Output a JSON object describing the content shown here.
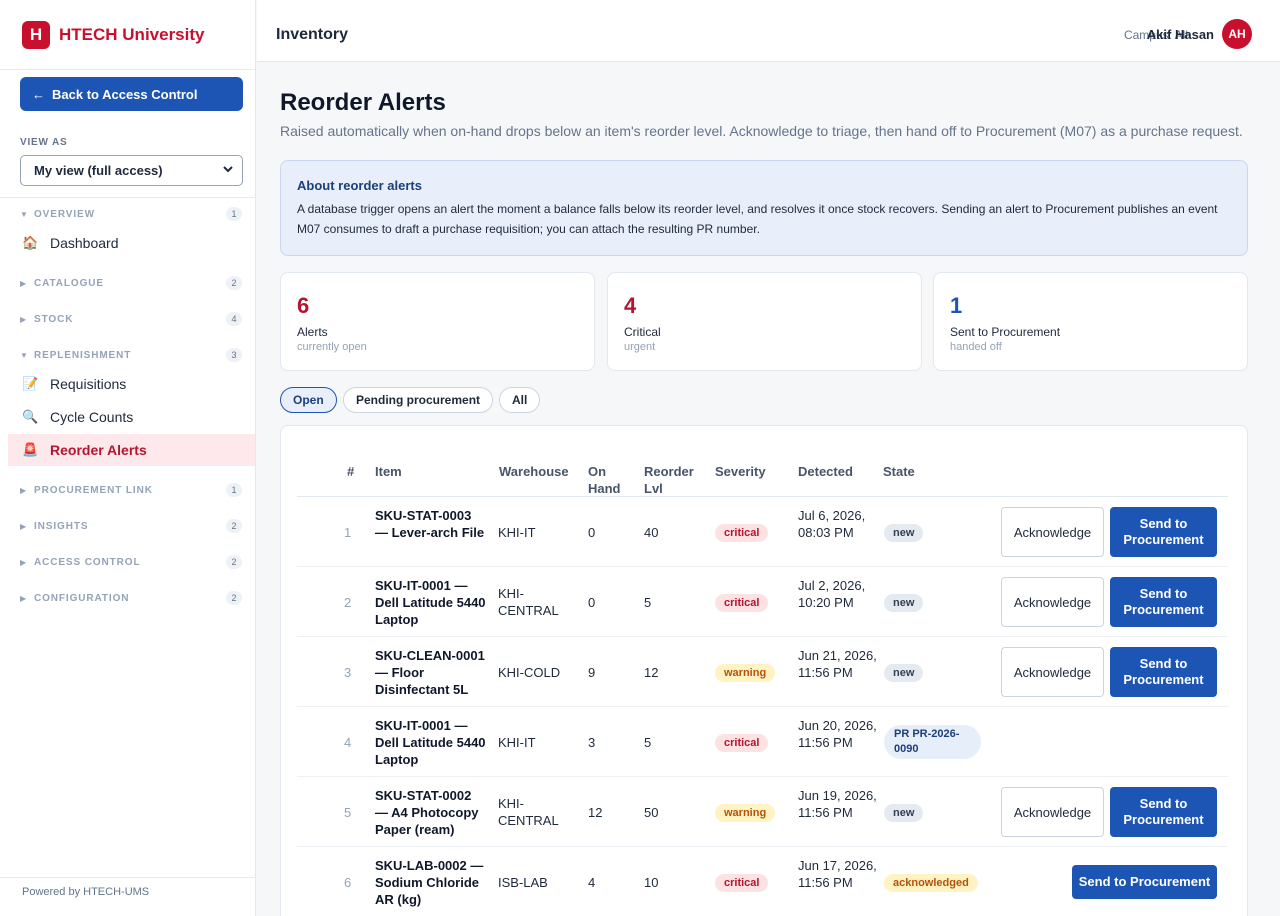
{
  "brand": {
    "logo_letter": "H",
    "name": "HTECH University",
    "color": "#c8102e"
  },
  "sidebar": {
    "back_label": "Back to Access Control",
    "view_as_label": "VIEW AS",
    "view_as_value": "My view (full access)",
    "sections": [
      {
        "title": "OVERVIEW",
        "count": "1",
        "expanded": true,
        "items": [
          {
            "label": "Dashboard",
            "icon": "house-icon"
          }
        ]
      },
      {
        "title": "CATALOGUE",
        "count": "2",
        "expanded": false,
        "items": []
      },
      {
        "title": "STOCK",
        "count": "4",
        "expanded": false,
        "items": []
      },
      {
        "title": "REPLENISHMENT",
        "count": "3",
        "expanded": true,
        "items": [
          {
            "label": "Requisitions",
            "icon": "memo-icon"
          },
          {
            "label": "Cycle Counts",
            "icon": "magnifier-icon"
          },
          {
            "label": "Reorder Alerts",
            "icon": "siren-icon",
            "active": true
          }
        ]
      },
      {
        "title": "PROCUREMENT LINK",
        "count": "1",
        "expanded": false,
        "items": []
      },
      {
        "title": "INSIGHTS",
        "count": "2",
        "expanded": false,
        "items": []
      },
      {
        "title": "ACCESS CONTROL",
        "count": "2",
        "expanded": false,
        "items": []
      },
      {
        "title": "CONFIGURATION",
        "count": "2",
        "expanded": false,
        "items": []
      }
    ],
    "footer": "Powered by HTECH-UMS"
  },
  "topbar": {
    "title": "Inventory",
    "campus": "Campus: All",
    "user_name": "Akif Hasan",
    "avatar_initials": "AH"
  },
  "page": {
    "title": "Reorder Alerts",
    "subtitle": "Raised automatically when on-hand drops below an item's reorder level. Acknowledge to triage, then hand off to Procurement (M07) as a purchase request."
  },
  "info": {
    "title": "About reorder alerts",
    "body": "A database trigger opens an alert the moment a balance falls below its reorder level, and resolves it once stock recovers. Sending an alert to Procurement publishes an event M07 consumes to draft a purchase requisition; you can attach the resulting PR number."
  },
  "stats": [
    {
      "value": "6",
      "label": "Alerts",
      "sub": "currently open",
      "color": "#b4152f"
    },
    {
      "value": "4",
      "label": "Critical",
      "sub": "urgent",
      "color": "#b4152f"
    },
    {
      "value": "1",
      "label": "Sent to Procurement",
      "sub": "handed off",
      "color": "#1d55b4"
    }
  ],
  "filters": [
    {
      "label": "Open",
      "active": true
    },
    {
      "label": "Pending procurement",
      "active": false
    },
    {
      "label": "All",
      "active": false
    }
  ],
  "table": {
    "headers": {
      "idx": "#",
      "item": "Item",
      "warehouse": "Warehouse",
      "on_hand": "On Hand",
      "reorder": "Reorder Lvl",
      "severity": "Severity",
      "detected": "Detected",
      "state": "State"
    },
    "actions": {
      "acknowledge": "Acknowledge",
      "send": "Send to Procurement"
    },
    "rows": [
      {
        "idx": "1",
        "item": "SKU-STAT-0003 — Lever-arch File",
        "warehouse": "KHI-IT",
        "on_hand": "0",
        "reorder": "40",
        "severity": "critical",
        "detected": "Jul 6, 2026, 08:03 PM",
        "state": "new",
        "actions": "both"
      },
      {
        "idx": "2",
        "item": "SKU-IT-0001 — Dell Latitude 5440 Laptop",
        "warehouse": "KHI-CENTRAL",
        "on_hand": "0",
        "reorder": "5",
        "severity": "critical",
        "detected": "Jul 2, 2026, 10:20 PM",
        "state": "new",
        "actions": "both"
      },
      {
        "idx": "3",
        "item": "SKU-CLEAN-0001 — Floor Disinfectant 5L",
        "warehouse": "KHI-COLD",
        "on_hand": "9",
        "reorder": "12",
        "severity": "warning",
        "detected": "Jun 21, 2026, 11:56 PM",
        "state": "new",
        "actions": "both"
      },
      {
        "idx": "4",
        "item": "SKU-IT-0001 — Dell Latitude 5440 Laptop",
        "warehouse": "KHI-IT",
        "on_hand": "3",
        "reorder": "5",
        "severity": "critical",
        "detected": "Jun 20, 2026, 11:56 PM",
        "state": "PR PR-2026-0090",
        "actions": "none"
      },
      {
        "idx": "5",
        "item": "SKU-STAT-0002 — A4 Photocopy Paper (ream)",
        "warehouse": "KHI-CENTRAL",
        "on_hand": "12",
        "reorder": "50",
        "severity": "warning",
        "detected": "Jun 19, 2026, 11:56 PM",
        "state": "new",
        "actions": "both"
      },
      {
        "idx": "6",
        "item": "SKU-LAB-0002 — Sodium Chloride AR (kg)",
        "warehouse": "ISB-LAB",
        "on_hand": "4",
        "reorder": "10",
        "severity": "critical",
        "detected": "Jun 17, 2026, 11:56 PM",
        "state": "acknowledged",
        "actions": "send"
      }
    ]
  }
}
